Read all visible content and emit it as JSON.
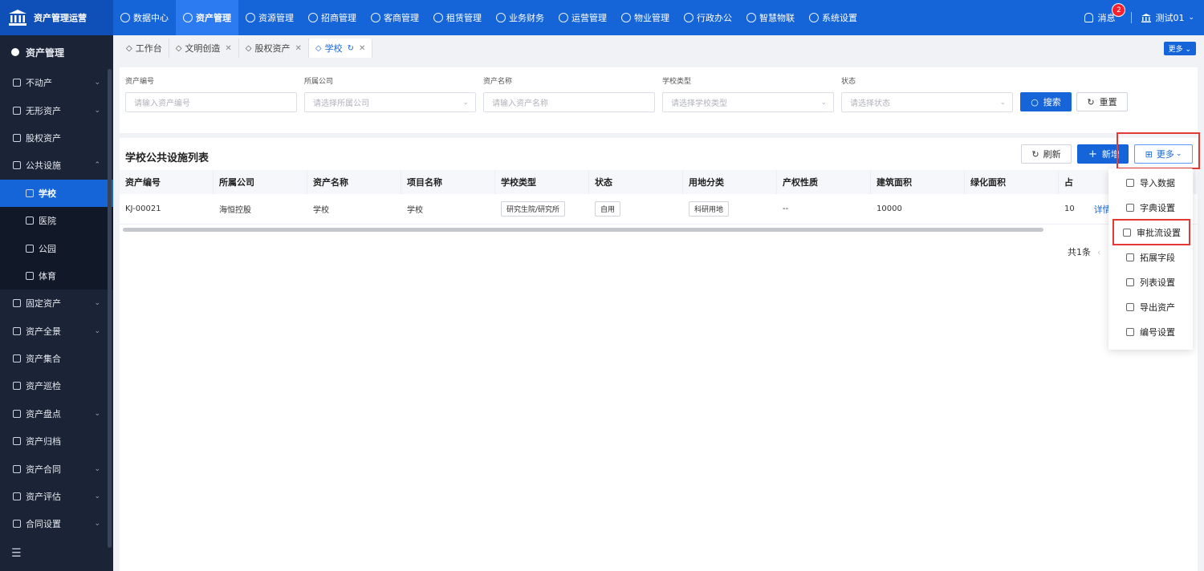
{
  "brand": {
    "title": "资产管理运营"
  },
  "nav": [
    {
      "label": "数据中心",
      "active": false
    },
    {
      "label": "资产管理",
      "active": true
    },
    {
      "label": "资源管理",
      "active": false
    },
    {
      "label": "招商管理",
      "active": false
    },
    {
      "label": "客商管理",
      "active": false
    },
    {
      "label": "租赁管理",
      "active": false
    },
    {
      "label": "业务财务",
      "active": false
    },
    {
      "label": "运营管理",
      "active": false
    },
    {
      "label": "物业管理",
      "active": false
    },
    {
      "label": "行政办公",
      "active": false
    },
    {
      "label": "智慧物联",
      "active": false
    },
    {
      "label": "系统设置",
      "active": false
    }
  ],
  "header": {
    "messages_label": "消息",
    "messages_count": "2",
    "user_name": "测试01"
  },
  "sidebar": {
    "title": "资产管理",
    "items": [
      {
        "label": "不动产",
        "chevron": "⌄"
      },
      {
        "label": "无形资产",
        "chevron": "⌄"
      },
      {
        "label": "股权资产",
        "chevron": ""
      },
      {
        "label": "公共设施",
        "chevron": "⌃"
      }
    ],
    "sub_items": [
      {
        "label": "学校",
        "active": true
      },
      {
        "label": "医院",
        "active": false
      },
      {
        "label": "公园",
        "active": false
      },
      {
        "label": "体育",
        "active": false
      }
    ],
    "items_after": [
      {
        "label": "固定资产",
        "chevron": "⌄"
      },
      {
        "label": "资产全景",
        "chevron": "⌄"
      },
      {
        "label": "资产集合",
        "chevron": ""
      },
      {
        "label": "资产巡检",
        "chevron": ""
      },
      {
        "label": "资产盘点",
        "chevron": "⌄"
      },
      {
        "label": "资产归档",
        "chevron": ""
      },
      {
        "label": "资产合同",
        "chevron": "⌄"
      },
      {
        "label": "资产评估",
        "chevron": "⌄"
      },
      {
        "label": "合同设置",
        "chevron": "⌄"
      }
    ]
  },
  "tabs": [
    {
      "label": "工作台",
      "closable": false,
      "active": false
    },
    {
      "label": "文明创造",
      "closable": true,
      "active": false
    },
    {
      "label": "股权资产",
      "closable": true,
      "active": false
    },
    {
      "label": "学校",
      "closable": true,
      "active": true
    }
  ],
  "tabs_more": "更多 ⌄",
  "search": {
    "fields": [
      {
        "label": "资产编号",
        "placeholder": "请输入资产编号",
        "select": false
      },
      {
        "label": "所属公司",
        "placeholder": "请选择所属公司",
        "select": true
      },
      {
        "label": "资产名称",
        "placeholder": "请输入资产名称",
        "select": false
      },
      {
        "label": "学校类型",
        "placeholder": "请选择学校类型",
        "select": true
      },
      {
        "label": "状态",
        "placeholder": "请选择状态",
        "select": true
      }
    ],
    "search_button": "搜索",
    "reset_button": "重置"
  },
  "list": {
    "title": "学校公共设施列表",
    "refresh_button": "刷新",
    "add_button": "新增",
    "more_button": "更多",
    "columns": [
      "资产编号",
      "所属公司",
      "资产名称",
      "项目名称",
      "学校类型",
      "状态",
      "用地分类",
      "产权性质",
      "建筑面积",
      "绿化面积",
      "占"
    ],
    "rows": [
      [
        "KJ-00021",
        "海恒控股",
        "学校",
        "学校",
        "研究生院/研究所",
        "自用",
        "科研用地",
        "--",
        "10000",
        "",
        "10"
      ]
    ],
    "row_action": "详情",
    "total": "共1条"
  },
  "more_menu": [
    "导入数据",
    "字典设置",
    "审批流设置",
    "拓展字段",
    "列表设置",
    "导出资产",
    "编号设置"
  ],
  "colors": {
    "primary": "#1565d8",
    "sidebar": "#1b2436",
    "highlight": "#e53935"
  }
}
